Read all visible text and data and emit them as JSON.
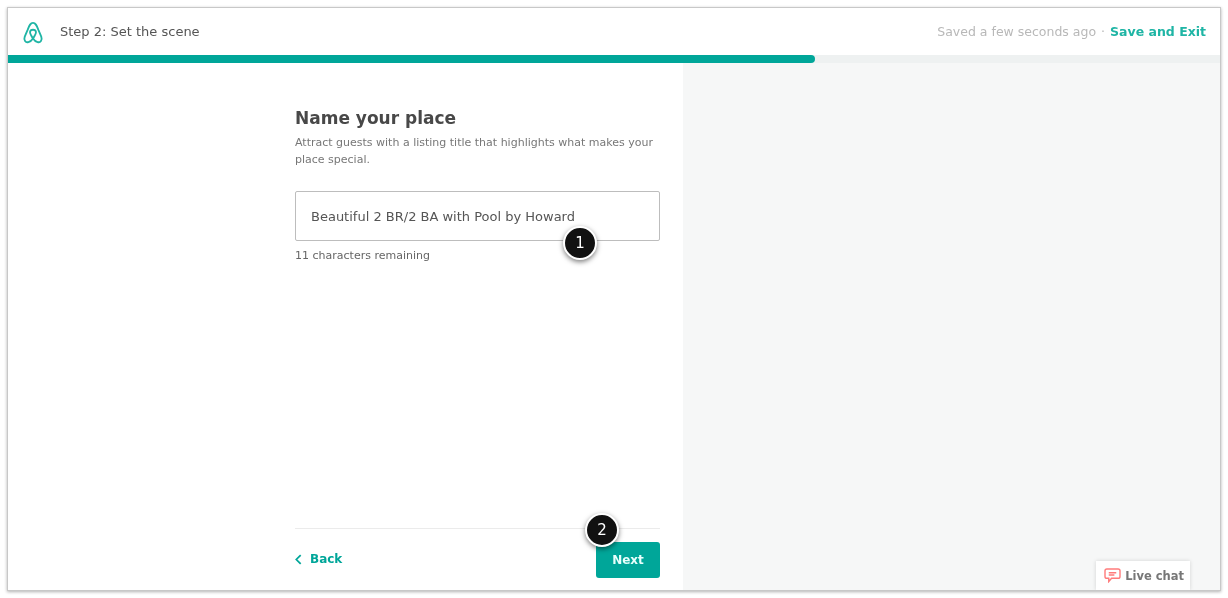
{
  "header": {
    "step_title": "Step 2: Set the scene",
    "save_status": "Saved a few seconds ago",
    "separator": "·",
    "save_exit": "Save and Exit"
  },
  "progress": {
    "level": 0.666
  },
  "form": {
    "title": "Name your place",
    "description": "Attract guests with a listing title that highlights what makes your place special.",
    "value": "Beautiful 2 BR/2 BA with Pool by Howard",
    "helper": "11 characters remaining"
  },
  "footer": {
    "back": "Back",
    "next": "Next"
  },
  "callouts": [
    {
      "number": "1"
    },
    {
      "number": "2"
    }
  ],
  "live_chat": {
    "label": "Live chat"
  }
}
